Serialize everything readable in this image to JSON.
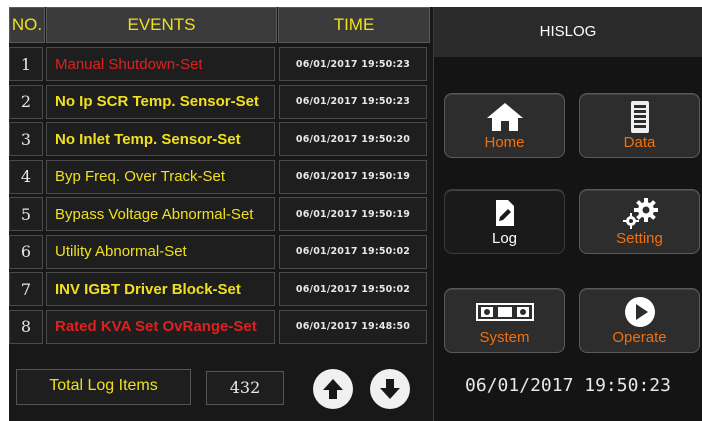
{
  "table": {
    "headers": {
      "no": "NO.",
      "events": "EVENTS",
      "time": "TIME"
    },
    "rows": [
      {
        "no": "1",
        "event": "Manual Shutdown-Set",
        "time": "06/01/2017 19:50:23",
        "color": "#e02020",
        "bold": false
      },
      {
        "no": "2",
        "event": "No Ip SCR Temp. Sensor-Set",
        "time": "06/01/2017 19:50:23",
        "color": "#f0e020",
        "bold": true
      },
      {
        "no": "3",
        "event": "No Inlet Temp. Sensor-Set",
        "time": "06/01/2017 19:50:20",
        "color": "#f0e020",
        "bold": true
      },
      {
        "no": "4",
        "event": "Byp Freq. Over Track-Set",
        "time": "06/01/2017 19:50:19",
        "color": "#f0e020",
        "bold": false
      },
      {
        "no": "5",
        "event": "Bypass Voltage Abnormal-Set",
        "time": "06/01/2017 19:50:19",
        "color": "#f0e020",
        "bold": false
      },
      {
        "no": "6",
        "event": "Utility Abnormal-Set",
        "time": "06/01/2017 19:50:02",
        "color": "#f0e020",
        "bold": false
      },
      {
        "no": "7",
        "event": "INV IGBT Driver Block-Set",
        "time": "06/01/2017 19:50:02",
        "color": "#f0e020",
        "bold": true
      },
      {
        "no": "8",
        "event": "Rated KVA Set OvRange-Set",
        "time": "06/01/2017 19:48:50",
        "color": "#e02020",
        "bold": true
      }
    ]
  },
  "footer": {
    "total_label": "Total Log Items",
    "total_value": "432",
    "up_icon": "arrow-up-icon",
    "down_icon": "arrow-down-icon"
  },
  "panel": {
    "title": "HISLOG",
    "buttons": {
      "home": {
        "label": "Home",
        "icon": "home-icon"
      },
      "data": {
        "label": "Data",
        "icon": "battery-icon"
      },
      "log": {
        "label": "Log",
        "icon": "document-edit-icon"
      },
      "setting": {
        "label": "Setting",
        "icon": "gears-icon"
      },
      "system": {
        "label": "System",
        "icon": "system-modules-icon"
      },
      "operate": {
        "label": "Operate",
        "icon": "play-icon"
      }
    },
    "clock": "06/01/2017 19:50:23"
  },
  "colors": {
    "header_text": "#f0e020",
    "alarm_red": "#e02020",
    "event_yellow": "#f0e020",
    "nav_label_orange": "#f07010"
  }
}
